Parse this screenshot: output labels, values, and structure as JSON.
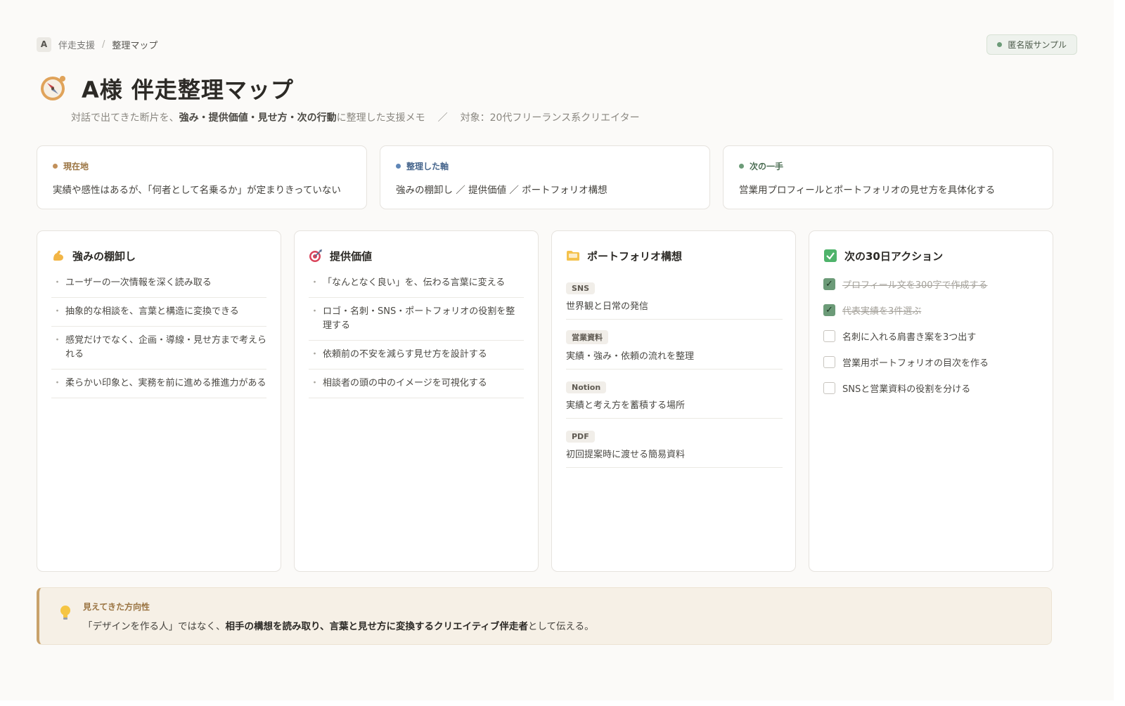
{
  "breadcrumb": {
    "avatar": "A",
    "parent": "伴走支援",
    "separator": "/",
    "current": "整理マップ"
  },
  "badge": {
    "label": "匿名版サンプル",
    "color": "#6c9b78"
  },
  "header": {
    "title": "A様 伴走整理マップ",
    "icon": "compass-icon",
    "subtitle": {
      "pre": "対話で出てきた断片を、",
      "bold": "強み・提供価値・見せ方・次の行動",
      "post": "に整理した支援メモ",
      "sep": "／",
      "target": "対象：20代フリーランス系クリエイター"
    }
  },
  "summary": [
    {
      "label": "現在地",
      "color": "#c2905a",
      "text": "実績や感性はあるが、「何者として名乗るか」が定まりきっていない"
    },
    {
      "label": "整理した軸",
      "color": "#5f86b7",
      "text": "強みの棚卸し ／ 提供価値 ／ ポートフォリオ構想"
    },
    {
      "label": "次の一手",
      "color": "#6c9b78",
      "text": "営業用プロフィールとポートフォリオの見せ方を具体化する"
    }
  ],
  "strengths": {
    "title": "強みの棚卸し",
    "icon": "flexed-arm-icon",
    "items": [
      "ユーザーの一次情報を深く読み取る",
      "抽象的な相談を、言葉と構造に変換できる",
      "感覚だけでなく、企画・導線・見せ方まで考えられる",
      "柔らかい印象と、実務を前に進める推進力がある"
    ]
  },
  "value": {
    "title": "提供価値",
    "icon": "target-icon",
    "items": [
      "「なんとなく良い」を、伝わる言葉に変える",
      "ロゴ・名刺・SNS・ポートフォリオの役割を整理する",
      "依頼前の不安を減らす見せ方を設計する",
      "相談者の頭の中のイメージを可視化する"
    ]
  },
  "portfolio": {
    "title": "ポートフォリオ構想",
    "icon": "folder-icon",
    "items": [
      {
        "tag": "SNS",
        "text": "世界観と日常の発信"
      },
      {
        "tag": "営業資料",
        "text": "実績・強み・依頼の流れを整理"
      },
      {
        "tag": "Notion",
        "text": "実績と考え方を蓄積する場所"
      },
      {
        "tag": "PDF",
        "text": "初回提案時に渡せる簡易資料"
      }
    ]
  },
  "actions": {
    "title": "次の30日アクション",
    "icon": "checkbox-icon",
    "items": [
      {
        "label": "プロフィール文を300字で作成する",
        "done": true
      },
      {
        "label": "代表実績を3件選ぶ",
        "done": true
      },
      {
        "label": "名刺に入れる肩書き案を3つ出す",
        "done": false
      },
      {
        "label": "営業用ポートフォリオの目次を作る",
        "done": false
      },
      {
        "label": "SNSと営業資料の役割を分ける",
        "done": false
      }
    ]
  },
  "direction": {
    "icon": "lightbulb-icon",
    "label": "見えてきた方向性",
    "pre": "「デザインを作る人」ではなく、",
    "bold": "相手の構想を読み取り、言葉と見せ方に変換するクリエイティブ伴走者",
    "post": "として伝える。"
  },
  "check_mark": "✓",
  "bullet": "・"
}
